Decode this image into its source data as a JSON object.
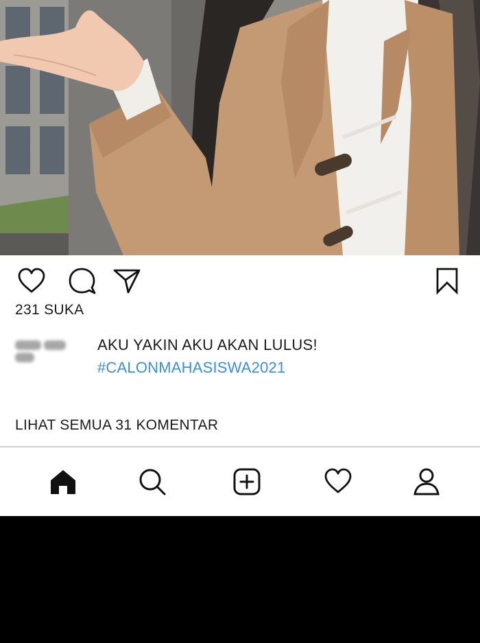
{
  "post": {
    "likes_text": "231 SUKA",
    "username": "amely_21",
    "caption": "AKU YAKIN AKU AKAN LULUS!",
    "hashtag": "#CALONMAHASISWA2021",
    "view_comments": "LIHAT SEMUA 31 KOMENTAR"
  },
  "actions": {
    "icons": [
      "heart-icon",
      "comment-icon",
      "send-icon",
      "bookmark-icon"
    ]
  },
  "bottom_nav": {
    "items": [
      "home-icon",
      "search-icon",
      "add-post-icon",
      "activity-heart-icon",
      "profile-icon"
    ],
    "active": "home-icon"
  },
  "colors": {
    "hashtag": "#3a8fd6",
    "text": "#1a1a1a",
    "background": "#ffffff",
    "coat": "#c49a74"
  }
}
